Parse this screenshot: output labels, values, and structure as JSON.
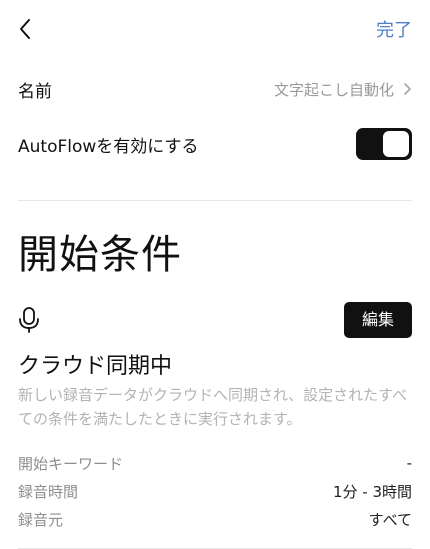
{
  "header": {
    "done_label": "完了"
  },
  "settings": {
    "name_label": "名前",
    "name_value": "文字起こし自動化",
    "autoflow_label": "AutoFlowを有効にする",
    "autoflow_enabled": true
  },
  "start_conditions": {
    "title": "開始条件",
    "edit_label": "編集",
    "trigger_title": "クラウド同期中",
    "trigger_description": "新しい録音データがクラウドへ同期され、設定されたすべての条件を満たしたときに実行されます。",
    "details": [
      {
        "key": "開始キーワード",
        "value": "-"
      },
      {
        "key": "録音時間",
        "value": "1分 - 3時間"
      },
      {
        "key": "録音元",
        "value": "すべて"
      }
    ]
  },
  "icons": {
    "back": "chevron-left-icon",
    "name_chevron": "chevron-right-icon",
    "trigger": "microphone-icon"
  },
  "colors": {
    "accent": "#4d7fc7",
    "toggle_on": "#111111",
    "muted_text": "#9a9a9a"
  }
}
